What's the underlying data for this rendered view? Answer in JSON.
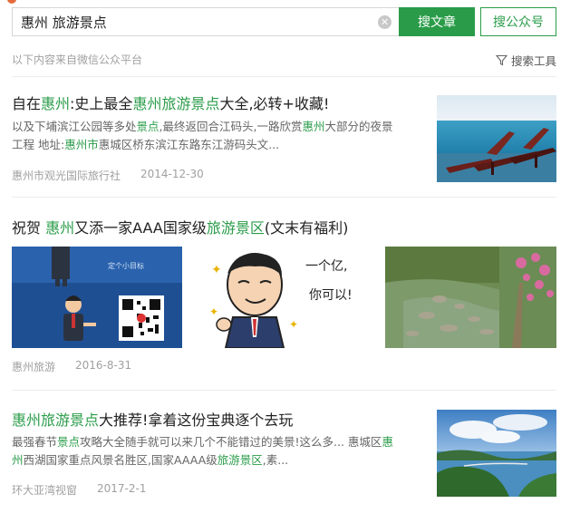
{
  "search": {
    "query": "惠州 旅游景点"
  },
  "buttons": {
    "search_articles": "搜文章",
    "search_accounts": "搜公众号"
  },
  "icons": {
    "clear": "clear-icon",
    "filter": "filter-icon"
  },
  "source_note": "以下内容来自微信公众平台",
  "tools_label": "搜索工具",
  "colors": {
    "accent": "#2a9c49",
    "muted": "#a0a0a0",
    "snippet": "#666666"
  },
  "results": [
    {
      "title": [
        "自在",
        "惠州",
        ":史上最全",
        "惠州旅游景点",
        "大全,必转+收藏!"
      ],
      "snippet_line1": [
        "以及下埔滨江公园等多处",
        "景点",
        ",最终返回合江码头,一路欣赏",
        "惠州",
        "大部分的夜景"
      ],
      "snippet_line2": [
        "工程 地址:",
        "惠州市",
        "惠城区桥东滨江东路东江游码头文..."
      ],
      "source": "惠州市观光国际旅行社",
      "date": "2014-12-30"
    },
    {
      "title": [
        "祝贺 ",
        "惠州",
        "又添一家AAA国家级",
        "旅游景区",
        "(文末有福利)"
      ],
      "image_text": {
        "speech_bubble": [
          "一个亿,",
          "你可以!"
        ],
        "banner_text": "定个小目标"
      },
      "source": "惠州旅游",
      "date": "2016-8-31"
    },
    {
      "title": [
        "惠州旅游景点",
        "大推荐!拿着这份宝典逐个去玩"
      ],
      "snippet_line1": [
        "最强春节",
        "景点",
        "攻略大全随手就可以来几个不能错过的美景!这么多... 惠城区",
        "惠"
      ],
      "snippet_line2": [
        "州",
        "西湖国家重点风景名胜区,国家AAAA级",
        "旅游景区",
        ",素..."
      ],
      "source": "环大亚湾视窗",
      "date": "2017-2-1"
    }
  ]
}
